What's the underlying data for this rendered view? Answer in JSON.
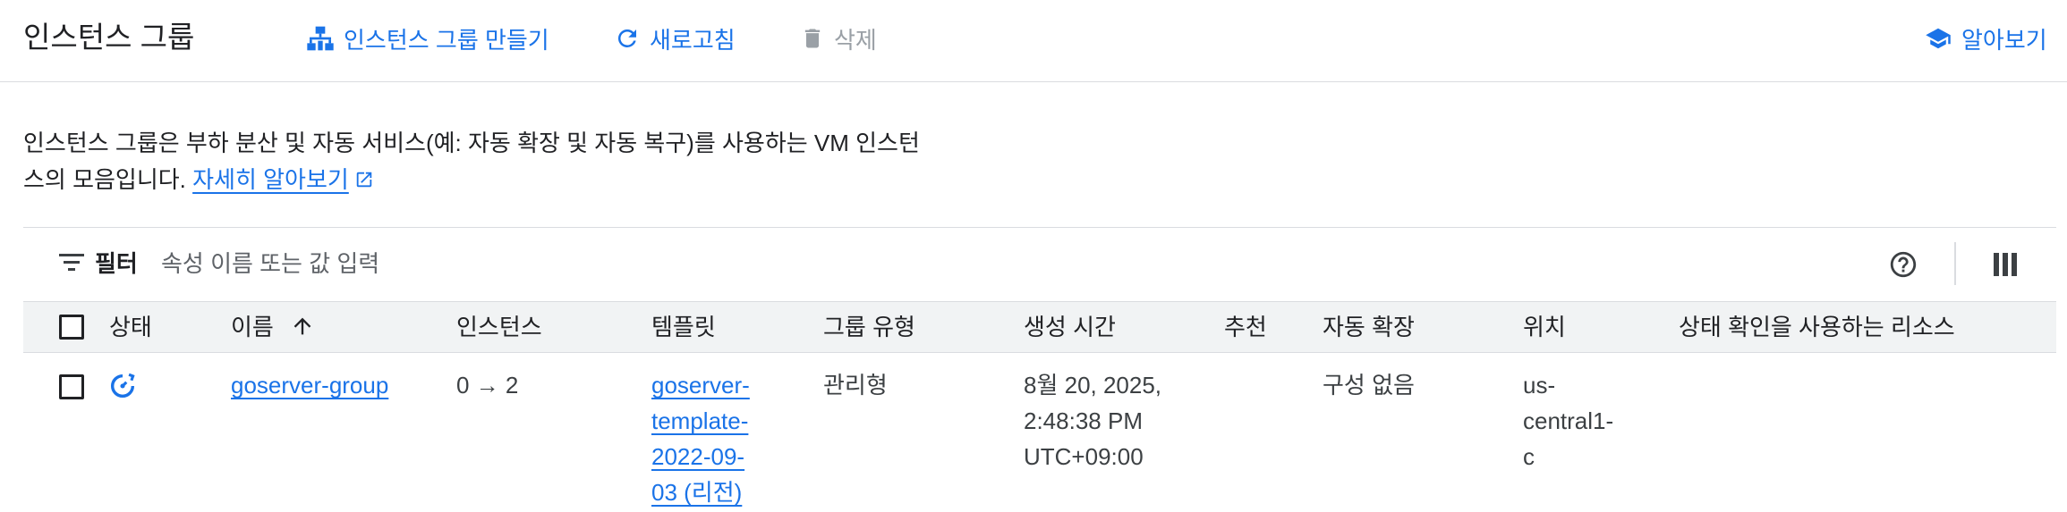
{
  "header": {
    "title": "인스턴스 그룹",
    "create_label": "인스턴스 그룹 만들기",
    "refresh_label": "새로고침",
    "delete_label": "삭제",
    "learn_label": "알아보기"
  },
  "description": {
    "line1": "인스턴스 그룹은 부하 분산 및 자동 서비스(예: 자동 확장 및 자동 복구)를 사용하는 VM 인스턴",
    "line2": "스의 모음입니다.",
    "link": "자세히 알아보기"
  },
  "filter": {
    "label": "필터",
    "placeholder": "속성 이름 또는 값 입력"
  },
  "table": {
    "columns": {
      "status": "상태",
      "name": "이름",
      "instances": "인스턴스",
      "template": "템플릿",
      "group_type": "그룹 유형",
      "created": "생성 시간",
      "recommendation": "추천",
      "autoscaling": "자동 확장",
      "location": "위치",
      "health_resources": "상태 확인을 사용하는 리소스"
    },
    "sort": {
      "column": "name",
      "direction": "ascending"
    },
    "rows": [
      {
        "status": "updating",
        "name": "goserver-group",
        "instances": "0 → 2",
        "template_lines": [
          "goserver-",
          "template-",
          "2022-09-",
          "03 (리전)"
        ],
        "group_type": "관리형",
        "created_lines": [
          "8월 20, 2025,",
          "2:48:38 PM",
          "UTC+09:00"
        ],
        "recommendation": "",
        "autoscaling": "구성 없음",
        "location_lines": [
          "us-",
          "central1-",
          "c"
        ],
        "health_resources": ""
      }
    ]
  },
  "colors": {
    "accent": "#1a73e8",
    "disabled": "#9aa0a6",
    "header_bg": "#f1f3f4",
    "border": "#dadce0"
  },
  "icons": {
    "create": "instance-group-add-icon",
    "refresh": "refresh-icon",
    "delete": "trash-icon",
    "learn": "school-icon",
    "external": "external-link-icon",
    "filter": "filter-lines-icon",
    "help": "help-circle-icon",
    "columns": "column-display-icon",
    "sort": "arrow-up-icon",
    "status": "sync-status-icon"
  }
}
